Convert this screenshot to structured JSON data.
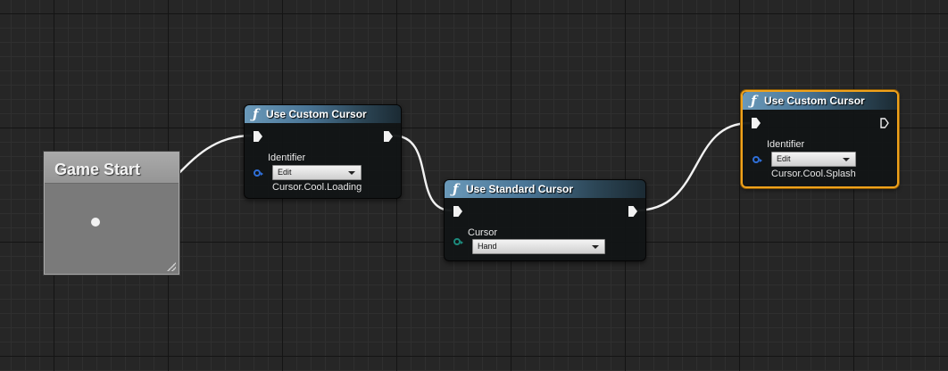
{
  "comment": {
    "title": "Game Start"
  },
  "nodes": [
    {
      "title": "Use Custom Cursor",
      "icon": "function-icon",
      "param_label": "Identifier",
      "dropdown_value": "Edit",
      "value": "Cursor.Cool.Loading"
    },
    {
      "title": "Use Standard Cursor",
      "icon": "function-icon",
      "param_label": "Cursor",
      "dropdown_value": "Hand"
    },
    {
      "title": "Use Custom Cursor",
      "icon": "function-icon",
      "param_label": "Identifier",
      "dropdown_value": "Edit",
      "value": "Cursor.Cool.Splash",
      "selected": true
    }
  ],
  "colors": {
    "background": "#262626",
    "header_blue": "#4a7596",
    "selection_outline": "#f0a21b",
    "object_pin": "#2f6fd8",
    "enum_pin": "#1c8b7d",
    "exec_wire": "#f2f2f2"
  },
  "function_glyph": "ƒ"
}
